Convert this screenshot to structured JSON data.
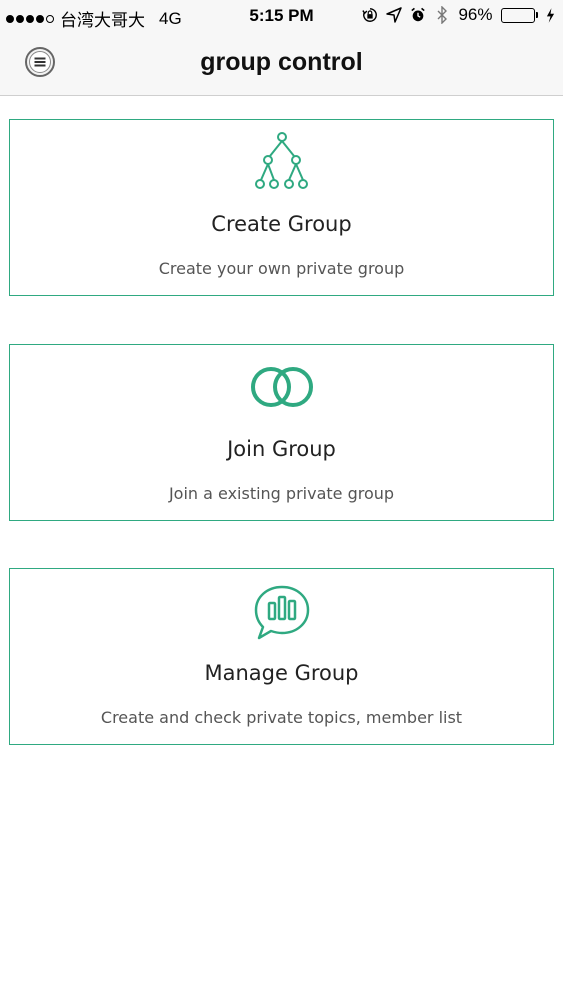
{
  "status_bar": {
    "carrier": "台湾大哥大",
    "network": "4G",
    "time": "5:15 PM",
    "battery_level": "96%",
    "battery_fraction": 0.96,
    "battery_color": "#4cd964",
    "icons": [
      "lock-rotation-icon",
      "location-arrow-icon",
      "alarm-icon",
      "bluetooth-icon",
      "battery-icon",
      "charging-bolt-icon"
    ]
  },
  "nav": {
    "title": "group control",
    "menu_icon": "menu-icon"
  },
  "accent_color": "#2fa981",
  "cards": [
    {
      "title": "Create Group",
      "description": "Create your own private group",
      "icon": "hierarchy-tree-icon"
    },
    {
      "title": "Join Group",
      "description": "Join a existing private group",
      "icon": "interlocking-rings-icon"
    },
    {
      "title": "Manage Group",
      "description": "Create and check private topics, member list",
      "icon": "chat-bar-chart-icon"
    }
  ]
}
